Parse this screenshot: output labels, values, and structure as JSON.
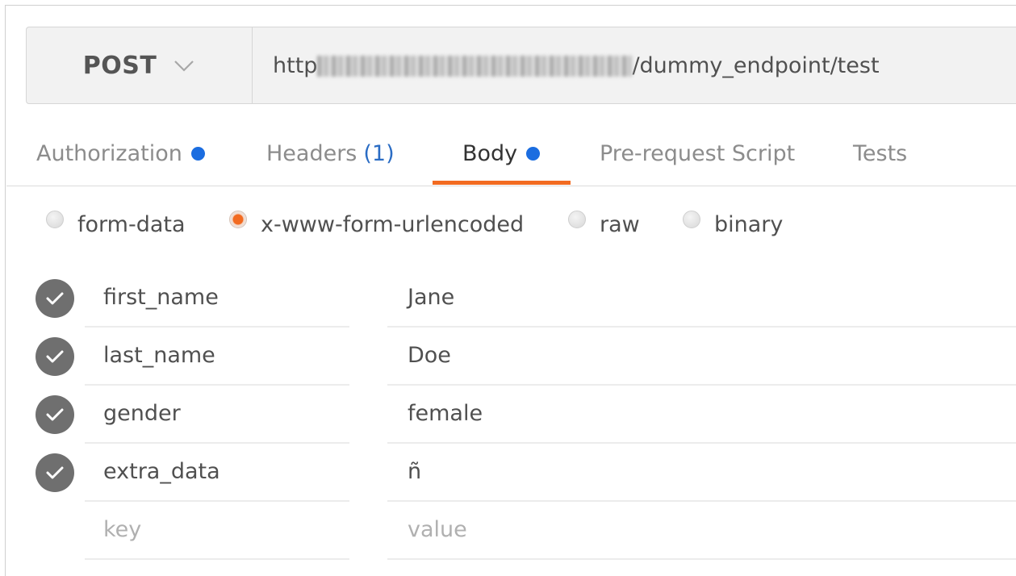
{
  "request": {
    "method": "POST",
    "url_prefix": "http",
    "url_suffix": "/dummy_endpoint/test"
  },
  "tabs": [
    {
      "label": "Authorization",
      "has_dot": true
    },
    {
      "label": "Headers",
      "count": "(1)"
    },
    {
      "label": "Body",
      "has_dot": true,
      "active": true
    },
    {
      "label": "Pre-request Script"
    },
    {
      "label": "Tests"
    }
  ],
  "body_types": [
    {
      "label": "form-data",
      "checked": false
    },
    {
      "label": "x-www-form-urlencoded",
      "checked": true
    },
    {
      "label": "raw",
      "checked": false
    },
    {
      "label": "binary",
      "checked": false
    }
  ],
  "params": [
    {
      "key": "first_name",
      "value": "Jane",
      "enabled": true
    },
    {
      "key": "last_name",
      "value": "Doe",
      "enabled": true
    },
    {
      "key": "gender",
      "value": "female",
      "enabled": true
    },
    {
      "key": "extra_data",
      "value": "ñ",
      "enabled": true
    }
  ],
  "new_param": {
    "key_placeholder": "key",
    "value_placeholder": "value"
  },
  "colors": {
    "accent": "#f26b21",
    "dot": "#1b6de0",
    "count": "#2a6cc4"
  },
  "icons": {
    "method_dropdown": "chevron-down-icon",
    "param_toggle": "check-circle-icon",
    "unsaved_indicator": "dot-icon"
  }
}
